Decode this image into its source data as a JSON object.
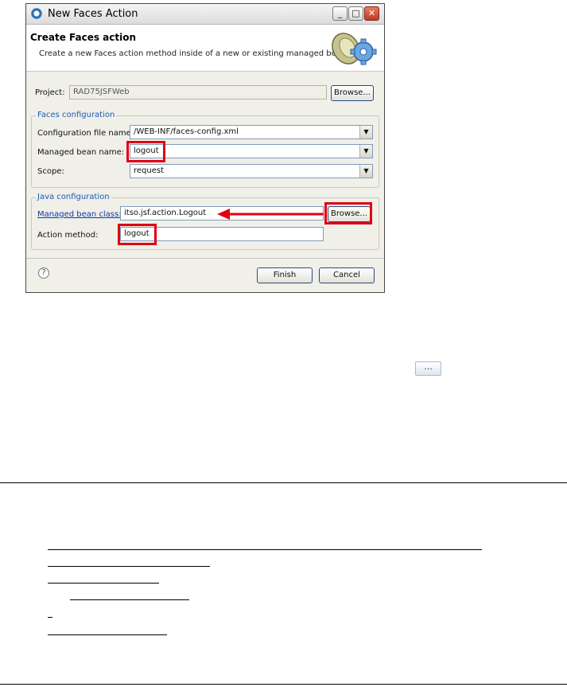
{
  "window": {
    "title": "New Faces Action"
  },
  "banner": {
    "title": "Create Faces action",
    "description": "Create a new Faces action method inside of a new or existing managed bean."
  },
  "project": {
    "label": "Project:",
    "value": "RAD75JSFWeb",
    "browse_label": "Browse..."
  },
  "faces_config": {
    "group_label": "Faces configuration",
    "config_file_label": "Configuration file name:",
    "config_file_value": "/WEB-INF/faces-config.xml",
    "bean_name_label": "Managed bean name:",
    "bean_name_value": "logout",
    "scope_label": "Scope:",
    "scope_value": "request"
  },
  "java_config": {
    "group_label": "Java configuration",
    "bean_class_label": "Managed bean class:",
    "bean_class_value": "itso.jsf.action.Logout",
    "browse_label": "Browse...",
    "action_method_label": "Action method:",
    "action_method_value": "logout"
  },
  "footer": {
    "help_glyph": "?",
    "finish_label": "Finish",
    "cancel_label": "Cancel"
  },
  "page": {
    "toolbar_button_glyph": "..."
  },
  "colors": {
    "highlight": "#e00012",
    "link": "#0a3ca8",
    "group_title": "#1a5cb4"
  }
}
